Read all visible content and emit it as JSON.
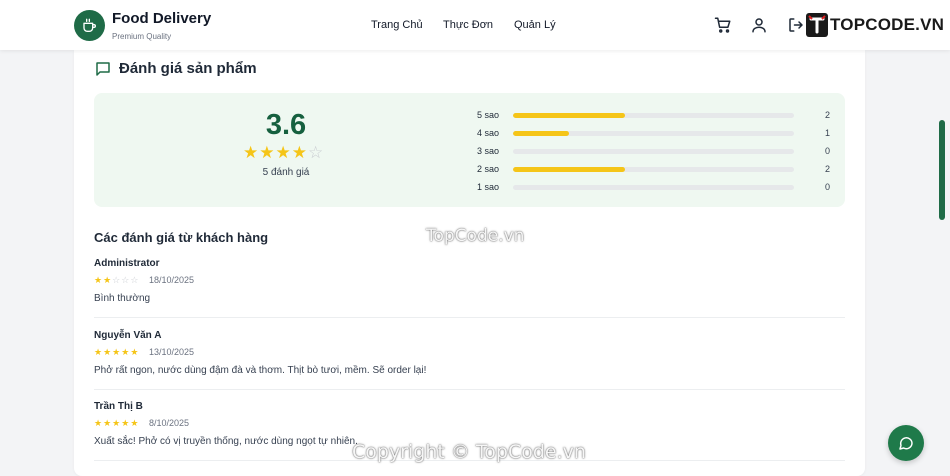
{
  "header": {
    "brand_name": "Food Delivery",
    "brand_sub": "Premium Quality",
    "nav": [
      "Trang Chủ",
      "Thực Đơn",
      "Quản Lý"
    ],
    "partner_logo_text": "TOPCODE.VN"
  },
  "rating": {
    "section_title": "Đánh giá sản phẩm",
    "average": "3.6",
    "average_stars": 3.6,
    "count_label": "5 đánh giá",
    "distribution": [
      {
        "label": "5 sao",
        "count": 2,
        "fraction": 0.4
      },
      {
        "label": "4 sao",
        "count": 1,
        "fraction": 0.2
      },
      {
        "label": "3 sao",
        "count": 0,
        "fraction": 0
      },
      {
        "label": "2 sao",
        "count": 2,
        "fraction": 0.4
      },
      {
        "label": "1 sao",
        "count": 0,
        "fraction": 0
      }
    ]
  },
  "reviews": {
    "title": "Các đánh giá từ khách hàng",
    "items": [
      {
        "name": "Administrator",
        "stars": 2,
        "date": "18/10/2025",
        "text": "Bình thường"
      },
      {
        "name": "Nguyễn Văn A",
        "stars": 5,
        "date": "13/10/2025",
        "text": "Phở rất ngon, nước dùng đậm đà và thơm. Thịt bò tươi, mềm. Sẽ order lại!"
      },
      {
        "name": "Trần Thị B",
        "stars": 5,
        "date": "8/10/2025",
        "text": "Xuất sắc! Phở có vị truyền thống, nước dùng ngọt tự nhiên."
      }
    ]
  },
  "watermarks": {
    "center": "TopCode.vn",
    "bottom": "Copyright © TopCode.vn"
  },
  "colors": {
    "primary": "#1f6b47",
    "star": "#f5c518",
    "summary_bg": "#eff8f1"
  }
}
